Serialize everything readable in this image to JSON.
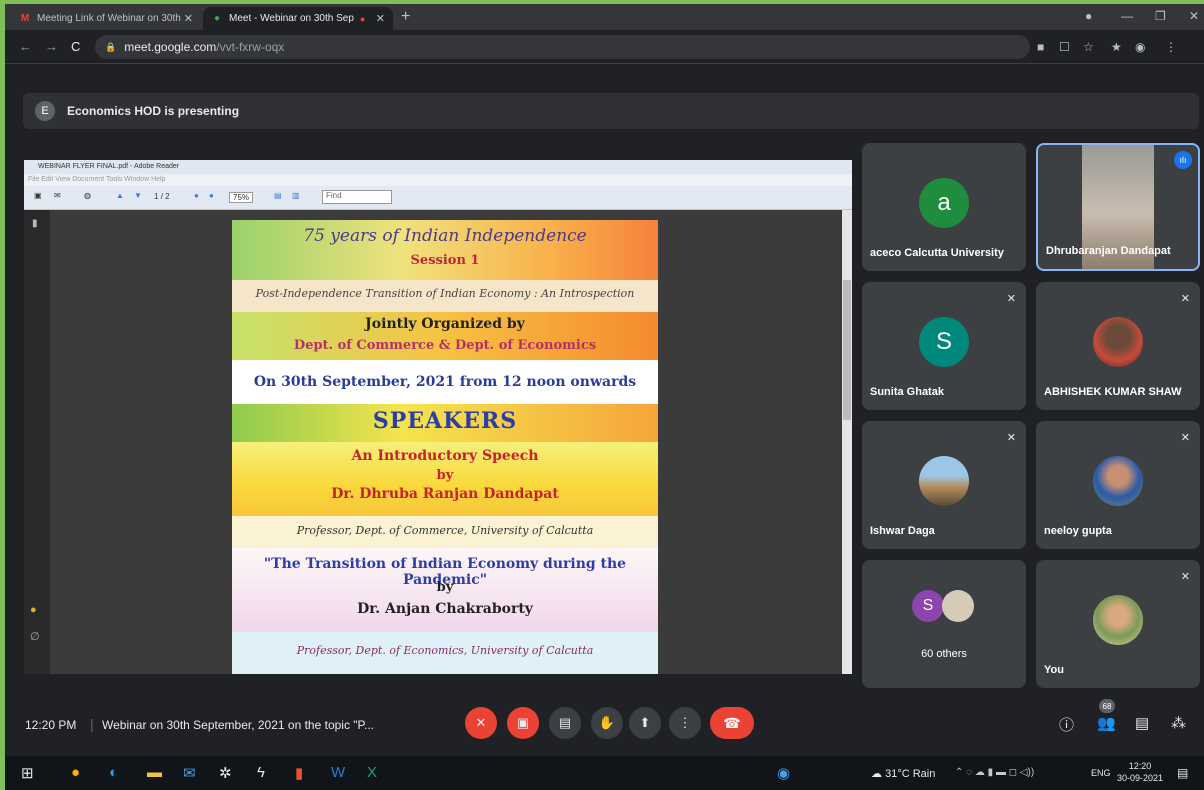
{
  "browser": {
    "tabs": [
      {
        "label": "Meeting Link of Webinar on 30th",
        "icon": "gmail-icon"
      },
      {
        "label": "Meet - Webinar on 30th Sep",
        "icon": "meet-icon"
      }
    ],
    "new_tab": "+",
    "url_host": "meet.google.com",
    "url_path": "/vvt-fxrw-oqx"
  },
  "banner": {
    "avatar_letter": "E",
    "text": "Economics HOD is presenting"
  },
  "reader": {
    "title": "WEBINAR FLYER FINAL.pdf - Adobe Reader",
    "menu": "File  Edit  View  Document  Tools  Window  Help",
    "page": "1",
    "page_total": "/ 2",
    "zoom": "75%",
    "find": "Find"
  },
  "flyer": {
    "title": "75 years of Indian Independence",
    "session": "Session 1",
    "theme": "Post-Independence Transition of Indian Economy : An Introspection",
    "joint": "Jointly Organized by",
    "depts": "Dept. of Commerce & Dept. of Economics",
    "date": "On 30th September, 2021 from 12 noon onwards",
    "speakers": "SPEAKERS",
    "intro": "An Introductory Speech",
    "by1": "by",
    "speaker1": "Dr. Dhruba Ranjan Dandapat",
    "aff1": "Professor, Dept. of Commerce,  University of Calcutta",
    "talk": "\"The Transition of Indian Economy during the Pandemic\"",
    "by2": "by",
    "speaker2": "Dr. Anjan Chakraborty",
    "aff2": "Professor, Dept. of Economics, University of Calcutta"
  },
  "participants": [
    {
      "name": "aceco Calcutta University",
      "letter": "a",
      "color": "#1e8e3e"
    },
    {
      "name": "Dhrubaranjan Dandapat"
    },
    {
      "name": "Sunita Ghatak",
      "letter": "S",
      "color": "#00897b"
    },
    {
      "name": "ABHISHEK KUMAR SHAW"
    },
    {
      "name": "Ishwar Daga"
    },
    {
      "name": "neeloy gupta"
    },
    {
      "name": "60 others",
      "letter": "S"
    },
    {
      "name": "You"
    }
  ],
  "meeting": {
    "time": "12:20 PM",
    "separator": "|",
    "title": "Webinar on 30th September, 2021 on the topic \"P...",
    "participant_count": "68"
  },
  "taskbar": {
    "weather": "31°C  Rain",
    "lang": "ENG",
    "time": "12:20",
    "date": "30-09-2021"
  }
}
